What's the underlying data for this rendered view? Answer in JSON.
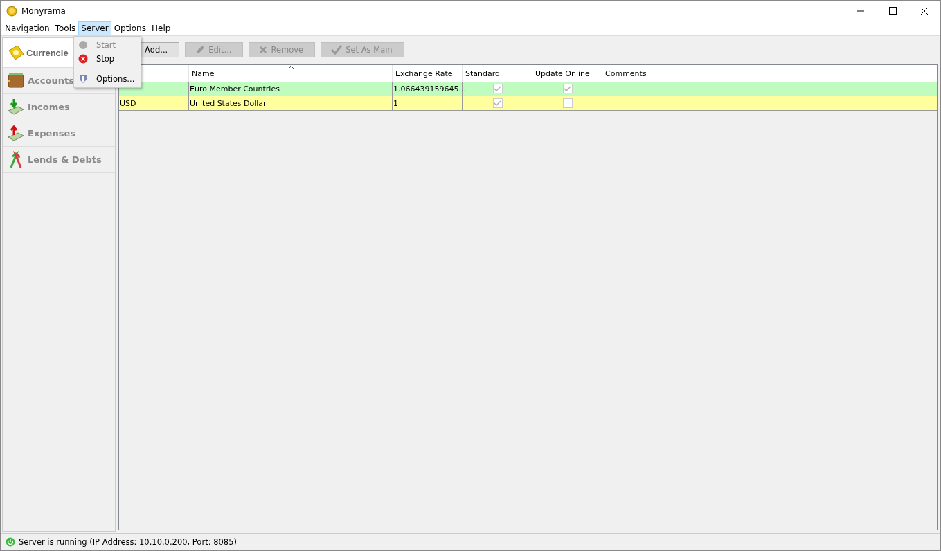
{
  "window": {
    "title": "Monyrama"
  },
  "menu_bar": [
    {
      "label": "Navigation",
      "selected": false
    },
    {
      "label": "Tools",
      "selected": false
    },
    {
      "label": "Server",
      "selected": true
    },
    {
      "label": "Options",
      "selected": false
    },
    {
      "label": "Help",
      "selected": false
    }
  ],
  "server_menu": [
    {
      "label": "Start",
      "kind": "start",
      "disabled": true
    },
    {
      "label": "Stop",
      "kind": "stop",
      "disabled": false
    },
    {
      "label": "Options...",
      "kind": "options",
      "disabled": false
    }
  ],
  "sidebar": {
    "items": [
      {
        "label": "Currencie",
        "kind": "currencies",
        "selected": true
      },
      {
        "label": "Accounts",
        "kind": "accounts",
        "selected": false
      },
      {
        "label": "Incomes",
        "kind": "incomes",
        "selected": false
      },
      {
        "label": "Expenses",
        "kind": "expenses",
        "selected": false
      },
      {
        "label": "Lends & Debts",
        "kind": "lends",
        "selected": false
      }
    ]
  },
  "toolbar": [
    {
      "label": "Add...",
      "kind": "add",
      "disabled": false
    },
    {
      "label": "Edit...",
      "kind": "edit",
      "disabled": true
    },
    {
      "label": "Remove",
      "kind": "remove",
      "disabled": true
    },
    {
      "label": "Set As Main",
      "kind": "main",
      "disabled": true
    }
  ],
  "table": {
    "columns": [
      {
        "label": "Name",
        "sorted": true
      },
      {
        "label": "Exchange Rate",
        "sorted": false
      },
      {
        "label": "Standard",
        "sorted": false
      },
      {
        "label": "Update Online",
        "sorted": false
      },
      {
        "label": "Comments",
        "sorted": false
      }
    ],
    "rows": [
      {
        "code": "",
        "name": "Euro Member Countries",
        "rate": "1.066439159645...",
        "standard": true,
        "update_online": true,
        "color": "#c0fbc0"
      },
      {
        "code": "USD",
        "name": "United States Dollar",
        "rate": "1",
        "standard": true,
        "update_online": false,
        "color": "#ffff9e"
      }
    ]
  },
  "status_bar": {
    "text": "Server is running (IP Address: 10.10.0.200, Port: 8085)",
    "running": true
  }
}
